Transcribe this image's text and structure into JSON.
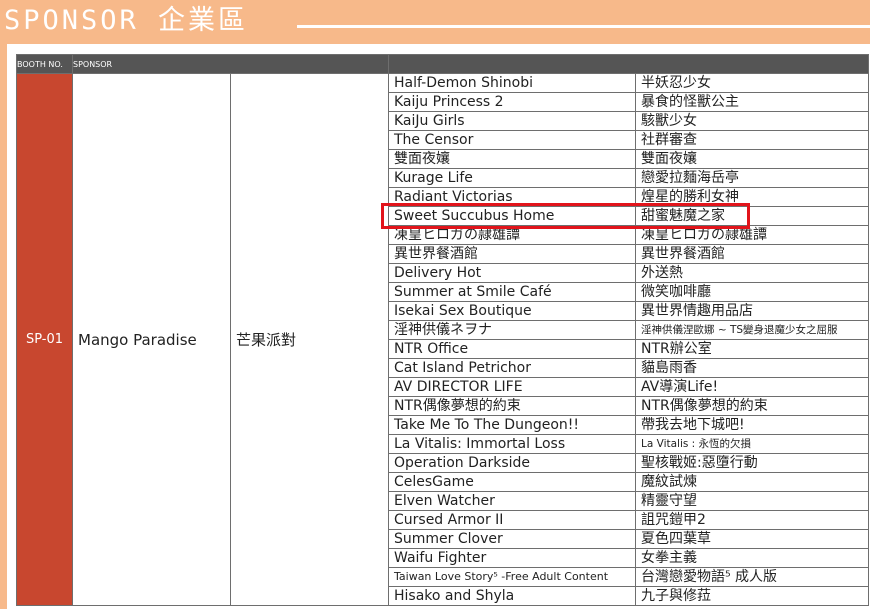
{
  "header": {
    "title": "SPONSOR 企業區"
  },
  "table": {
    "columns": [
      "BOOTH NO.",
      "SPONSOR"
    ],
    "booth": "SP-01",
    "sponsor_en": "Mango Paradise",
    "sponsor_zh": "芒果派對",
    "games": [
      {
        "en": "Half-Demon Shinobi",
        "zh": "半妖忍少女"
      },
      {
        "en": "Kaiju Princess 2",
        "zh": "暴食的怪獸公主"
      },
      {
        "en": "KaiJu Girls",
        "zh": "駭獸少女"
      },
      {
        "en": "The Censor",
        "zh": "社群審查"
      },
      {
        "en": "雙面夜孃",
        "zh": "雙面夜孃"
      },
      {
        "en": "Kurage Life",
        "zh": "戀愛拉麵海岳亭"
      },
      {
        "en": "Radiant Victorias",
        "zh": "煌星的勝利女神"
      },
      {
        "en": "Sweet Succubus Home",
        "zh": "甜蜜魅魔之家"
      },
      {
        "en": "凍皇ヒロガの隷雄譚",
        "zh": "凍皇ヒロガの隷雄譚"
      },
      {
        "en": "異世界餐酒館",
        "zh": "異世界餐酒館"
      },
      {
        "en": "Delivery Hot",
        "zh": "外送熱"
      },
      {
        "en": "Summer at Smile Café",
        "zh": "微笑咖啡廳"
      },
      {
        "en": "Isekai Sex Boutique",
        "zh": "異世界情趣用品店"
      },
      {
        "en": "淫神供儀ネヲナ",
        "zh": "淫神供儀涅歐娜 ~ TS變身退魔少女之屈服"
      },
      {
        "en": "NTR Office",
        "zh": "NTR辦公室"
      },
      {
        "en": "Cat Island Petrichor",
        "zh": "貓島雨香"
      },
      {
        "en": "AV DIRECTOR LIFE",
        "zh": "AV導演Life!"
      },
      {
        "en": "NTR偶像夢想的約束",
        "zh": "NTR偶像夢想的約束"
      },
      {
        "en": "Take Me To The Dungeon!!",
        "zh": "帶我去地下城吧!"
      },
      {
        "en": "La Vitalis: Immortal Loss",
        "zh": "La Vitalis : 永恆的欠損"
      },
      {
        "en": "Operation Darkside",
        "zh": "聖核戰姬:惡墮行動"
      },
      {
        "en": "CelesGame",
        "zh": "魔紋試煉"
      },
      {
        "en": "Elven Watcher",
        "zh": "精靈守望"
      },
      {
        "en": "Cursed Armor II",
        "zh": "詛咒鎧甲2"
      },
      {
        "en": "Summer Clover",
        "zh": "夏色四葉草"
      },
      {
        "en": "Waifu Fighter",
        "zh": "女拳主義"
      },
      {
        "en": "Taiwan Love Story⁵ -Free Adult Content",
        "zh": "台灣戀愛物語⁵ 成人版"
      },
      {
        "en": "Hisako and Shyla",
        "zh": "九子與修菈"
      }
    ]
  }
}
